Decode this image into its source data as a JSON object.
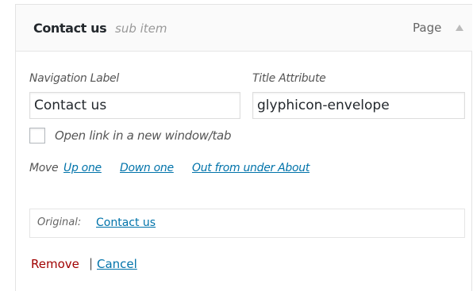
{
  "menu_item": {
    "title": "Contact us",
    "subtitle": "sub item",
    "type_label": "Page",
    "toggle_icon": "arrow-up-icon"
  },
  "fields": {
    "navigation_label": {
      "label": "Navigation Label",
      "value": "Contact us"
    },
    "title_attribute": {
      "label": "Title Attribute",
      "value": "glyphicon-envelope"
    },
    "new_window": {
      "label": "Open link in a new window/tab",
      "checked": false
    }
  },
  "move": {
    "label": "Move",
    "links": [
      "Up one",
      "Down one",
      "Out from under About"
    ]
  },
  "original": {
    "label": "Original:",
    "link_text": "Contact us"
  },
  "actions": {
    "remove": "Remove",
    "separator": "|",
    "cancel": "Cancel"
  },
  "colors": {
    "link": "#0073aa",
    "remove": "#a00000",
    "border": "#e5e5e5",
    "header_bg": "#fafafa"
  }
}
